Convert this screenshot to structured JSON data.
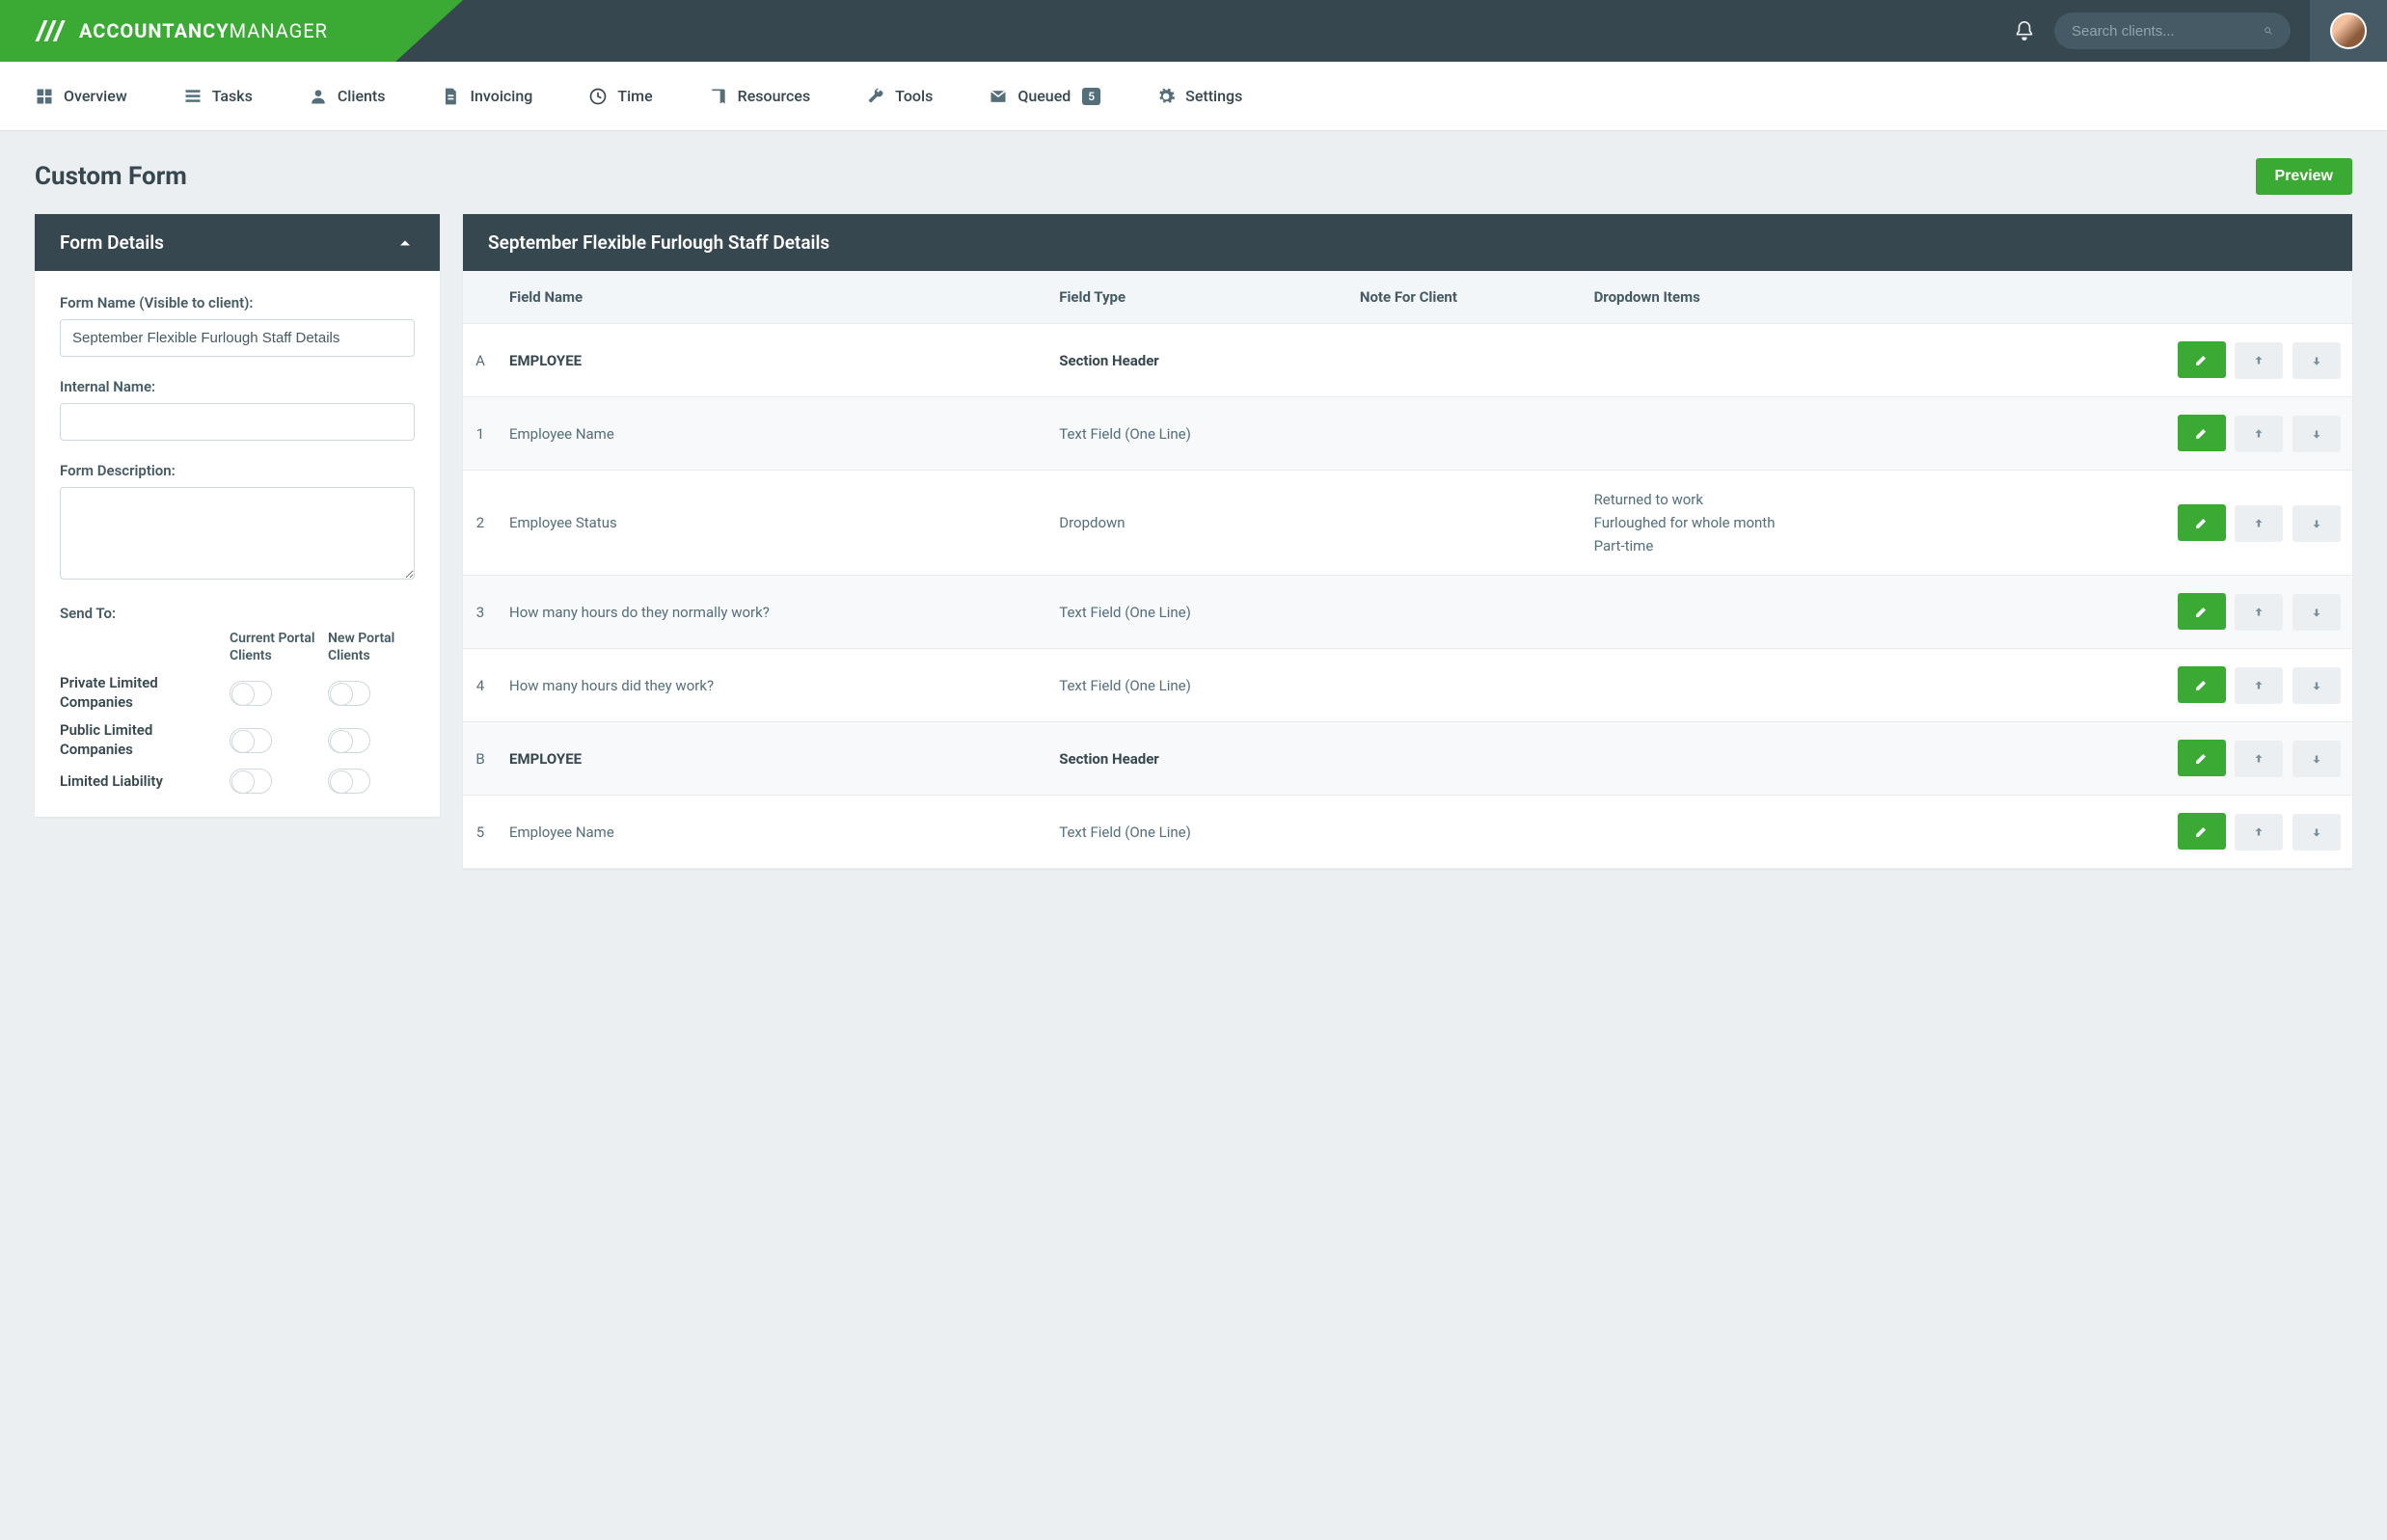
{
  "brand": {
    "left": "ACCOUNTANCY",
    "right": "MANAGER"
  },
  "search": {
    "placeholder": "Search clients..."
  },
  "nav": [
    {
      "label": "Overview",
      "icon": "grid"
    },
    {
      "label": "Tasks",
      "icon": "list"
    },
    {
      "label": "Clients",
      "icon": "person"
    },
    {
      "label": "Invoicing",
      "icon": "doc"
    },
    {
      "label": "Time",
      "icon": "clock"
    },
    {
      "label": "Resources",
      "icon": "book"
    },
    {
      "label": "Tools",
      "icon": "wrench"
    },
    {
      "label": "Queued",
      "icon": "mail",
      "badge": "5"
    },
    {
      "label": "Settings",
      "icon": "gear"
    }
  ],
  "page": {
    "title": "Custom Form",
    "preview": "Preview"
  },
  "formPanel": {
    "header": "Form Details",
    "nameLabel": "Form Name (Visible to client):",
    "nameValue": "September Flexible Furlough Staff Details",
    "internalLabel": "Internal Name:",
    "internalValue": "",
    "descLabel": "Form Description:",
    "descValue": "",
    "sendToLabel": "Send To:",
    "col1": "Current Portal Clients",
    "col2": "New Portal Clients",
    "rows": [
      {
        "label": "Private Limited Companies"
      },
      {
        "label": "Public Limited Companies"
      },
      {
        "label": "Limited Liability"
      }
    ]
  },
  "rightPanel": {
    "header": "September Flexible Furlough Staff Details"
  },
  "table": {
    "heads": [
      "",
      "Field Name",
      "Field Type",
      "Note For Client",
      "Dropdown Items",
      ""
    ],
    "rows": [
      {
        "idx": "A",
        "name": "EMPLOYEE",
        "bold": true,
        "type": "Section Header",
        "note": "",
        "dd": []
      },
      {
        "idx": "1",
        "name": "Employee Name",
        "type": "Text Field (One Line)",
        "note": "",
        "dd": []
      },
      {
        "idx": "2",
        "name": "Employee Status",
        "type": "Dropdown",
        "note": "",
        "dd": [
          "Returned to work",
          "Furloughed for whole month",
          "Part-time"
        ]
      },
      {
        "idx": "3",
        "name": "How many hours do they normally work?",
        "type": "Text Field (One Line)",
        "note": "",
        "dd": []
      },
      {
        "idx": "4",
        "name": "How many hours did they work?",
        "type": "Text Field (One Line)",
        "note": "",
        "dd": []
      },
      {
        "idx": "B",
        "name": "EMPLOYEE",
        "bold": true,
        "type": "Section Header",
        "note": "",
        "dd": []
      },
      {
        "idx": "5",
        "name": "Employee Name",
        "type": "Text Field (One Line)",
        "note": "",
        "dd": []
      }
    ]
  }
}
